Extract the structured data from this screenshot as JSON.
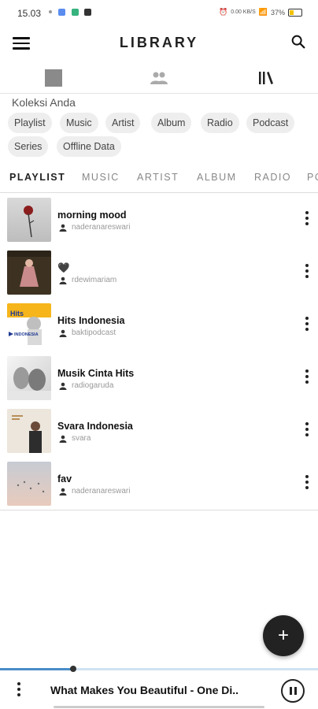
{
  "status": {
    "time": "15.03",
    "network_speed": "0.00 KB/S",
    "battery": "37%"
  },
  "header": {
    "title": "LIBRARY"
  },
  "collection": {
    "label": "Koleksi Anda",
    "chips": [
      "Playlist",
      "Music",
      "Artist",
      "Album",
      "Radio",
      "Podcast",
      "Series",
      "Offline Data"
    ]
  },
  "tabs": [
    "PLAYLIST",
    "MUSIC",
    "ARTIST",
    "ALBUM",
    "RADIO",
    "PO"
  ],
  "playlists": [
    {
      "title": "morning mood",
      "owner": "naderanareswari"
    },
    {
      "title": "🖤",
      "owner": "rdewimariam"
    },
    {
      "title": "Hits Indonesia",
      "owner": "baktipodcast",
      "thumb_text": "Hits",
      "thumb_subtext": "INDONESIA"
    },
    {
      "title": "Musik Cinta Hits",
      "owner": "radiogaruda"
    },
    {
      "title": "Svara Indonesia",
      "owner": "svara"
    },
    {
      "title": "fav",
      "owner": "naderanareswari"
    }
  ],
  "player": {
    "track": "What Makes You Beautiful - One Di..",
    "progress": 0.23
  },
  "colors": {
    "accent": "#4a8cc8",
    "fab": "#222222",
    "chip_bg": "#eeeeee"
  }
}
